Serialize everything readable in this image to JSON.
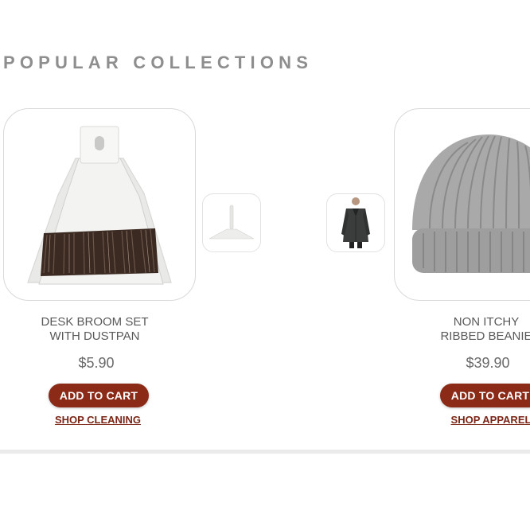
{
  "section": {
    "title": "POPULAR COLLECTIONS"
  },
  "products": [
    {
      "name_line1": "DESK BROOM SET",
      "name_line2": "WITH DUSTPAN",
      "price": "$5.90",
      "button_label": "ADD TO CART",
      "link_label": "SHOP CLEANING",
      "image": "broom-dustpan-image",
      "thumbnail": "squeegee-thumbnail"
    },
    {
      "name_line1": "NON ITCHY",
      "name_line2": "RIBBED BEANIE",
      "price": "$39.90",
      "button_label": "ADD TO CART",
      "link_label": "SHOP APPAREL",
      "image": "beanie-image",
      "thumbnail": "coat-thumbnail"
    }
  ],
  "colors": {
    "button": "#8a2a17",
    "link": "#7a2516",
    "title": "#8e8e8e"
  }
}
